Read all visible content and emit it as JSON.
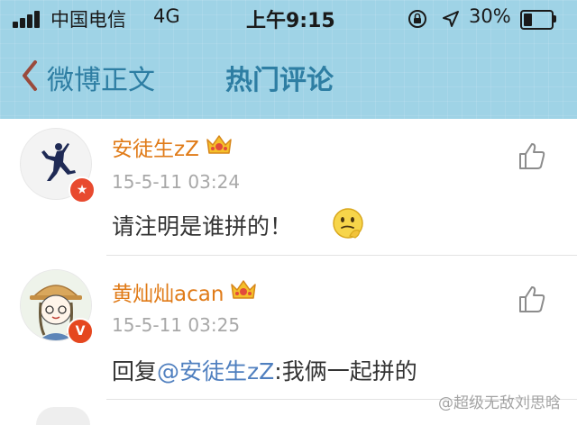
{
  "status_bar": {
    "carrier": "中国电信",
    "network": "4G",
    "time": "上午9:15",
    "battery_percent": "30%",
    "battery_level": 0.3
  },
  "nav": {
    "back_label": "微博正文",
    "title": "热门评论"
  },
  "comments": [
    {
      "username": "安徒生zZ",
      "timestamp": "15-5-11 03:24",
      "text": "请注明是谁拼的！",
      "has_emoji": true,
      "avatar_badge": "★"
    },
    {
      "username": "黄灿灿acan",
      "timestamp": "15-5-11 03:25",
      "text_prefix": "回复",
      "mention": "@安徒生zZ",
      "text_suffix": ":我俩一起拼的",
      "avatar_badge": "V"
    }
  ],
  "watermark": "@超级无敌刘思晗",
  "colors": {
    "header_bg": "#9fd3e6",
    "nav_text": "#2e7ea3",
    "username": "#e07b18",
    "mention": "#4f7fbf",
    "timestamp": "#a8a8a8"
  }
}
